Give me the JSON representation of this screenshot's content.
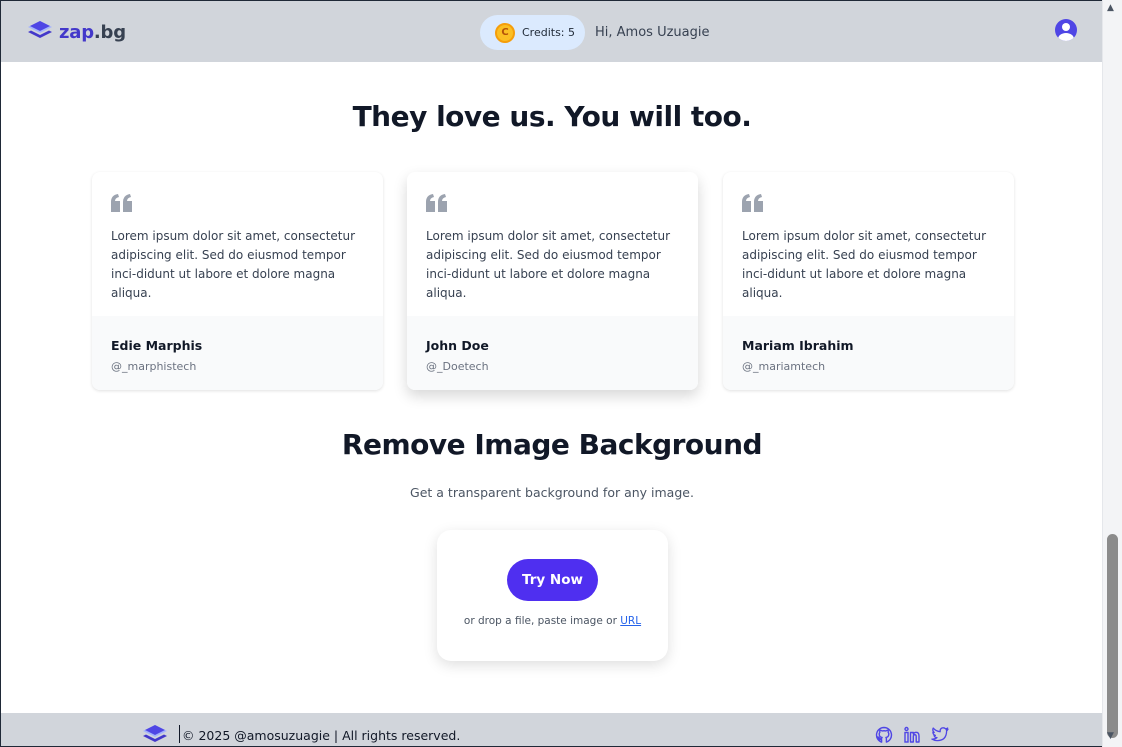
{
  "header": {
    "brand_name": "zap",
    "brand_tld": ".bg",
    "credits_label": "Credits: 5",
    "greeting": "Hi, Amos Uzuagie"
  },
  "testimonials": {
    "title": "They love us. You will too.",
    "items": [
      {
        "text": "Lorem ipsum dolor sit amet, consectetur adipiscing elit. Sed do eiusmod tempor inci-didunt ut labore et dolore magna aliqua.",
        "name": "Edie Marphis",
        "handle": "@_marphistech"
      },
      {
        "text": "Lorem ipsum dolor sit amet, consectetur adipiscing elit. Sed do eiusmod tempor inci-didunt ut labore et dolore magna aliqua.",
        "name": "John Doe",
        "handle": "@_Doetech"
      },
      {
        "text": "Lorem ipsum dolor sit amet, consectetur adipiscing elit. Sed do eiusmod tempor inci-didunt ut labore et dolore magna aliqua.",
        "name": "Mariam Ibrahim",
        "handle": "@_mariamtech"
      }
    ]
  },
  "remove_bg": {
    "title": "Remove Image Background",
    "subtitle": "Get a transparent background for any image.",
    "button_label": "Try Now",
    "drop_text": "or drop a file, paste image or",
    "url_link": "URL"
  },
  "footer": {
    "copyright": "© 2025 @amosuzuagie | All rights reserved.",
    "social_icons": [
      "github-icon",
      "linkedin-icon",
      "twitter-icon"
    ]
  },
  "colors": {
    "brand": "#4338ca",
    "accent_button": "#4f2ff0",
    "header_bg": "#d1d5db",
    "credits_bg": "#dbeafe"
  }
}
